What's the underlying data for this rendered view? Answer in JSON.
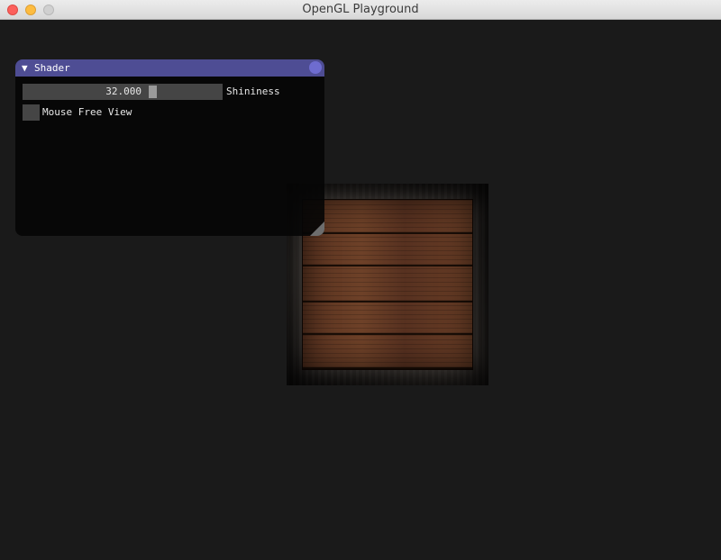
{
  "window": {
    "title": "OpenGL Playground"
  },
  "shader_panel": {
    "title": "Shader",
    "collapse_glyph": "▼",
    "shininess": {
      "value_text": "32.000",
      "value": 32.0,
      "label": "Shininess"
    },
    "mouse_free_view": {
      "label": "Mouse Free View",
      "checked": false
    }
  },
  "colors": {
    "background": "#1a1a1a",
    "panel_title_bar": "#4e4d94",
    "panel_close_button": "#6e6ccf",
    "widget_frame": "#454545",
    "traffic_close": "#fc605c",
    "traffic_minimize": "#fdbc40"
  },
  "icons": {
    "close": "close-icon",
    "minimize": "minimize-icon",
    "zoom": "zoom-icon",
    "collapse": "chevron-down-icon",
    "resize": "resize-grip-icon"
  }
}
